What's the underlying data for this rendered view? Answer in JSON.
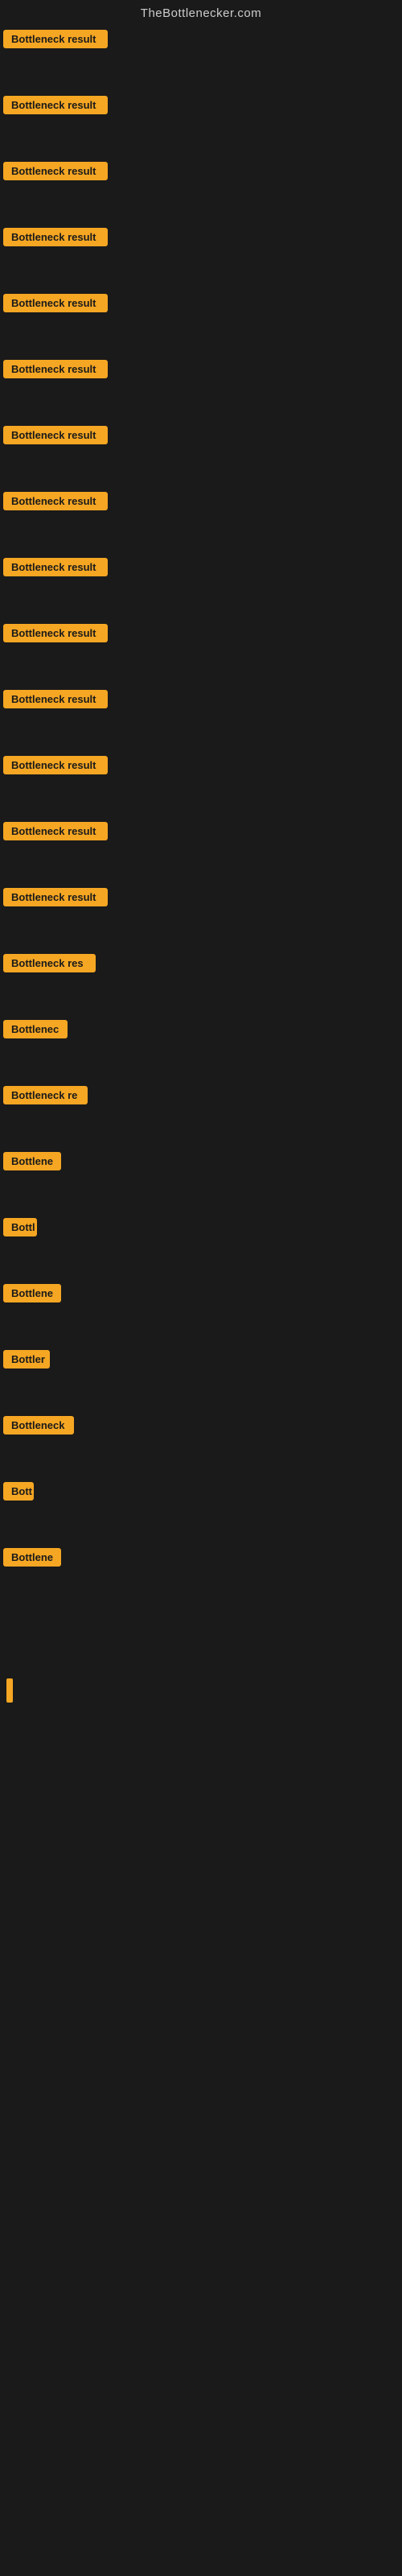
{
  "header": {
    "title": "TheBottlenecker.com"
  },
  "items": [
    {
      "label": "Bottleneck result",
      "width": "full"
    },
    {
      "label": "Bottleneck result",
      "width": "full"
    },
    {
      "label": "Bottleneck result",
      "width": "full"
    },
    {
      "label": "Bottleneck result",
      "width": "full"
    },
    {
      "label": "Bottleneck result",
      "width": "full"
    },
    {
      "label": "Bottleneck result",
      "width": "full"
    },
    {
      "label": "Bottleneck result",
      "width": "full"
    },
    {
      "label": "Bottleneck result",
      "width": "full"
    },
    {
      "label": "Bottleneck result",
      "width": "full"
    },
    {
      "label": "Bottleneck result",
      "width": "full"
    },
    {
      "label": "Bottleneck result",
      "width": "full"
    },
    {
      "label": "Bottleneck result",
      "width": "full"
    },
    {
      "label": "Bottleneck result",
      "width": "full"
    },
    {
      "label": "Bottleneck result",
      "width": "full"
    },
    {
      "label": "Bottleneck res",
      "width": "partial-lg"
    },
    {
      "label": "Bottlenec",
      "width": "partial-md"
    },
    {
      "label": "Bottleneck re",
      "width": "partial-lg2"
    },
    {
      "label": "Bottlene",
      "width": "partial-sm"
    },
    {
      "label": "Bottl",
      "width": "partial-xs"
    },
    {
      "label": "Bottlene",
      "width": "partial-sm"
    },
    {
      "label": "Bottler",
      "width": "partial-sm2"
    },
    {
      "label": "Bottleneck",
      "width": "partial-md2"
    },
    {
      "label": "Bott",
      "width": "partial-xs2"
    },
    {
      "label": "Bottlene",
      "width": "partial-sm"
    }
  ]
}
